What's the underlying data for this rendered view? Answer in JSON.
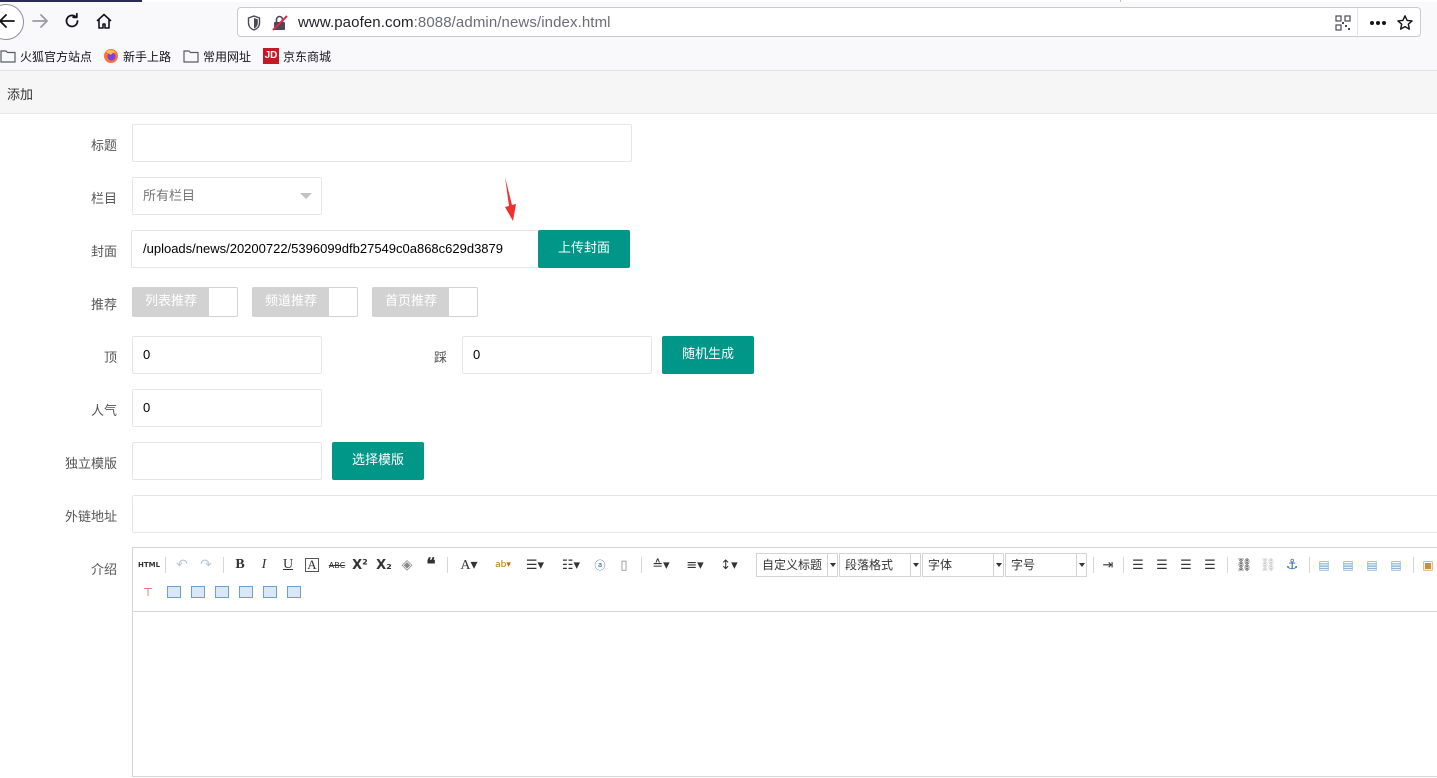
{
  "browser": {
    "url_host": "www.paofen.com",
    "url_rest": ":8088/admin/news/index.html",
    "bookmarks": [
      "火狐官方站点",
      "新手上路",
      "常用网址",
      "京东商城"
    ],
    "jd_badge": "JD"
  },
  "page": {
    "tab_title": "添加",
    "form": {
      "title_label": "标题",
      "title_value": "",
      "category_label": "栏目",
      "category_value": "所有栏目",
      "cover_label": "封面",
      "cover_value": "/uploads/news/20200722/5396099dfb27549c0a868c629d3879",
      "upload_button": "上传封面",
      "recommend_label": "推荐",
      "recommend_switches": [
        "列表推荐",
        "频道推荐",
        "首页推荐"
      ],
      "top_label": "顶",
      "top_value": "0",
      "step_label": "踩",
      "step_value": "0",
      "random_button": "随机生成",
      "popularity_label": "人气",
      "popularity_value": "0",
      "template_label": "独立模版",
      "template_value": "",
      "template_button": "选择模版",
      "link_label": "外链地址",
      "link_value": "",
      "intro_label": "介绍"
    },
    "editor": {
      "html_button": "HTML",
      "combo_heading": "自定义标题",
      "combo_paragraph": "段落格式",
      "combo_font": "字体",
      "combo_size": "字号"
    }
  }
}
